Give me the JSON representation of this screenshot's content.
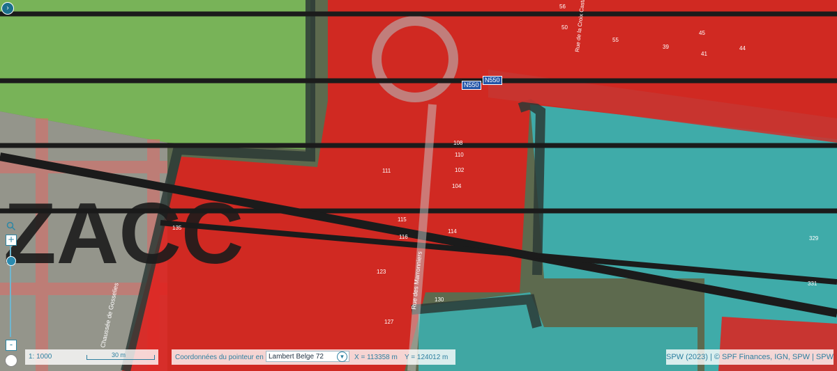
{
  "map": {
    "zone_label": "ZACC",
    "road_signs": [
      "N550",
      "N550"
    ],
    "street_labels": [
      "Rue des Marronniers",
      "Rue de la Croix Castaigne",
      "Chaussée de Gosselies"
    ],
    "house_numbers": [
      "111",
      "110",
      "108",
      "102",
      "104",
      "115",
      "116",
      "114",
      "135",
      "123",
      "130",
      "127",
      "329",
      "331",
      "56",
      "55",
      "50",
      "45",
      "41",
      "44",
      "39"
    ],
    "colors": {
      "agricultural_zone": "#7cc05a",
      "residential_zone": "#e0201c",
      "green_space_zone": "#35c2c8",
      "roads": "#1b1b1b",
      "accent": "#2c87a6"
    }
  },
  "controls": {
    "expand_icon": "chevron-right-icon",
    "zoom_icon": "magnifier-icon",
    "zoom_in_label": "+",
    "zoom_out_label": "-",
    "zoom_level_fraction": 0.2
  },
  "scale": {
    "ratio": "1: 1000",
    "bar_label": "30 m"
  },
  "coordinates": {
    "label": "Coordonnées du pointeur en",
    "projection": "Lambert Belge 72",
    "x": "X = 113358 m",
    "y": "Y = 124012 m"
  },
  "attribution": "SPW (2023) | © SPF Finances, IGN, SPW | SPW"
}
